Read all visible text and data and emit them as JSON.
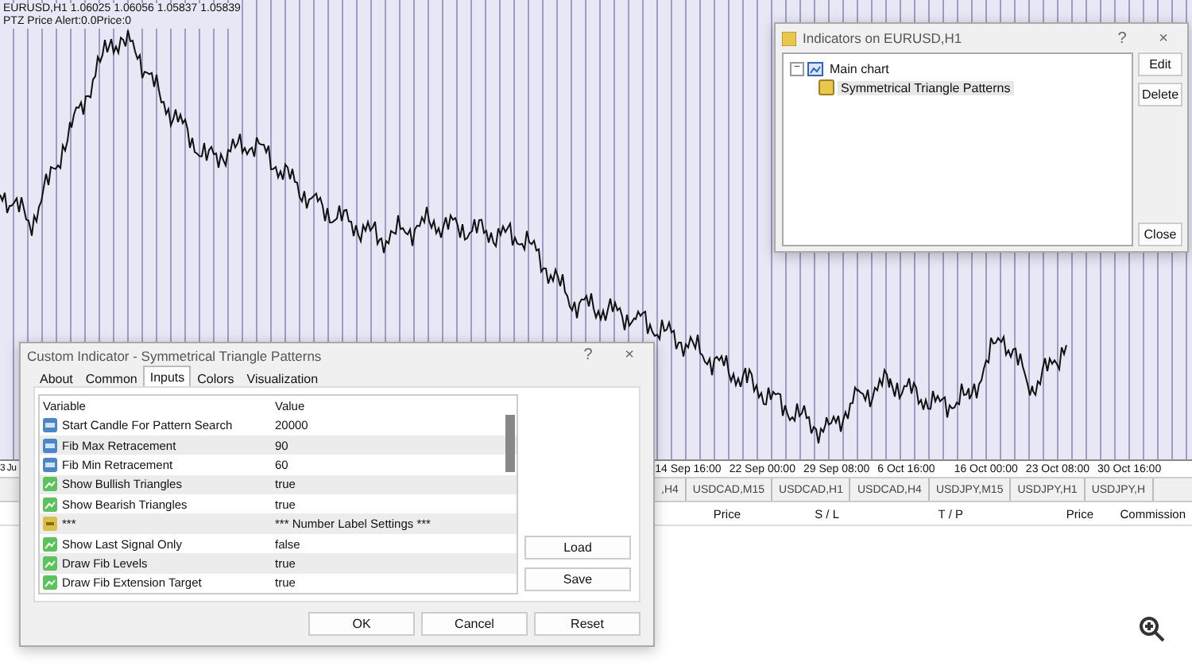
{
  "chart": {
    "header": "EURUSD,H1  1.06025 1.06056 1.05837 1.05839",
    "subheader": "PTZ Price Alert:0.0Price:0",
    "time_axis_left": "3 Ju",
    "time_axis": [
      "14 Sep 16:00",
      "22 Sep 00:00",
      "29 Sep 08:00",
      "6 Oct 16:00",
      "16 Oct 00:00",
      "23 Oct 08:00",
      "30 Oct 16:00"
    ]
  },
  "symbol_tabs": [
    ",H4",
    "USDCAD,M15",
    "USDCAD,H1",
    "USDCAD,H4",
    "USDJPY,M15",
    "USDJPY,H1",
    "USDJPY,H"
  ],
  "trade_columns": [
    "Price",
    "S / L",
    "T / P",
    "Price",
    "Commission"
  ],
  "indicators_dialog": {
    "title": "Indicators on EURUSD,H1",
    "help": "?",
    "close": "×",
    "tree": [
      {
        "label": "Main chart",
        "expanded": true,
        "expander": "−",
        "children": [
          {
            "label": "Symmetrical Triangle Patterns",
            "selected": true
          }
        ]
      }
    ],
    "buttons": [
      "Edit",
      "Delete",
      "Close"
    ]
  },
  "custom_dialog": {
    "title": "Custom Indicator - Symmetrical Triangle Patterns",
    "help": "?",
    "close": "×",
    "tabs": [
      {
        "label": "About",
        "selected": false
      },
      {
        "label": "Common",
        "selected": false
      },
      {
        "label": "Inputs",
        "selected": true
      },
      {
        "label": "Colors",
        "selected": false
      },
      {
        "label": "Visualization",
        "selected": false
      }
    ],
    "columns": [
      "Variable",
      "Value"
    ],
    "rows": [
      {
        "kind": "number",
        "variable": "Start Candle For Pattern Search",
        "value": "20000"
      },
      {
        "kind": "number",
        "variable": "Fib Max Retracement",
        "value": "90"
      },
      {
        "kind": "number",
        "variable": "Fib Min Retracement",
        "value": "60"
      },
      {
        "kind": "bool",
        "variable": "Show Bullish Triangles",
        "value": "true"
      },
      {
        "kind": "bool",
        "variable": "Show Bearish Triangles",
        "value": "true"
      },
      {
        "kind": "string",
        "variable": "***",
        "value": "*** Number Label Settings ***"
      },
      {
        "kind": "bool",
        "variable": "Show Last Signal Only",
        "value": "false"
      },
      {
        "kind": "bool",
        "variable": "Draw Fib Levels",
        "value": "true"
      },
      {
        "kind": "bool",
        "variable": "Draw Fib Extension Target",
        "value": "true"
      }
    ],
    "side_buttons": [
      "Load",
      "Save"
    ],
    "buttons": [
      "OK",
      "Cancel",
      "Reset"
    ]
  }
}
